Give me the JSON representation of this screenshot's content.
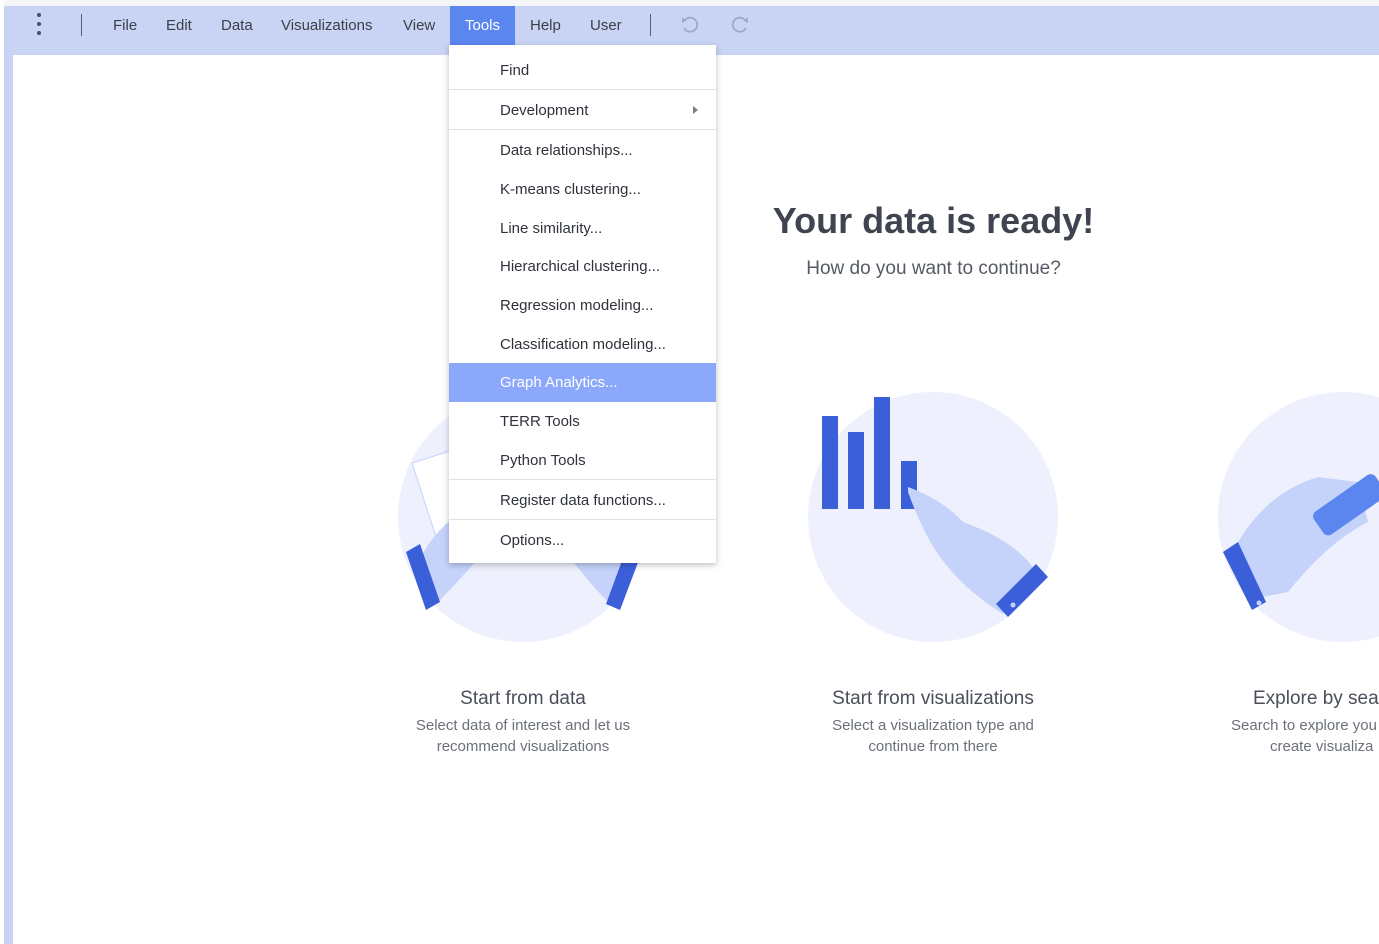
{
  "menubar": {
    "items": [
      {
        "label": "File"
      },
      {
        "label": "Edit"
      },
      {
        "label": "Data"
      },
      {
        "label": "Visualizations"
      },
      {
        "label": "View"
      },
      {
        "label": "Tools",
        "active": true
      },
      {
        "label": "Help"
      },
      {
        "label": "User"
      }
    ],
    "icons": [
      "more-vertical-icon",
      "undo-icon",
      "redo-icon"
    ]
  },
  "tools_menu": {
    "items": [
      {
        "label": "Find"
      },
      {
        "label": "Development",
        "has_submenu": true
      },
      {
        "label": "Data relationships..."
      },
      {
        "label": "K-means clustering..."
      },
      {
        "label": "Line similarity..."
      },
      {
        "label": "Hierarchical clustering..."
      },
      {
        "label": "Regression modeling..."
      },
      {
        "label": "Classification modeling..."
      },
      {
        "label": "Graph Analytics...",
        "highlighted": true
      },
      {
        "label": "TERR Tools"
      },
      {
        "label": "Python Tools"
      },
      {
        "label": "Register data functions..."
      },
      {
        "label": "Options..."
      }
    ]
  },
  "main": {
    "title": "Your data is ready!",
    "subtitle": "How do you want to continue?",
    "cards": [
      {
        "title": "Start from data",
        "desc_line1": "Select data of interest and let us",
        "desc_line2": "recommend visualizations",
        "icon": "hands-with-document-icon"
      },
      {
        "title": "Start from visualizations",
        "desc_line1": "Select a visualization type and",
        "desc_line2": "continue from there",
        "icon": "bar-chart-pointing-hand-icon"
      },
      {
        "title": "Explore by sea",
        "desc_line1": "Search to explore you",
        "desc_line2": "create visualiza",
        "icon": "hand-with-magnifier-icon"
      }
    ]
  },
  "colors": {
    "menubar_bg": "#c9d4f5",
    "menu_active": "#5b86f0",
    "menu_highlight": "#8ca8fb",
    "illustration_blue": "#3a5fd9",
    "illustration_light": "#c5d3fb",
    "circle_bg": "#eef1fd"
  }
}
